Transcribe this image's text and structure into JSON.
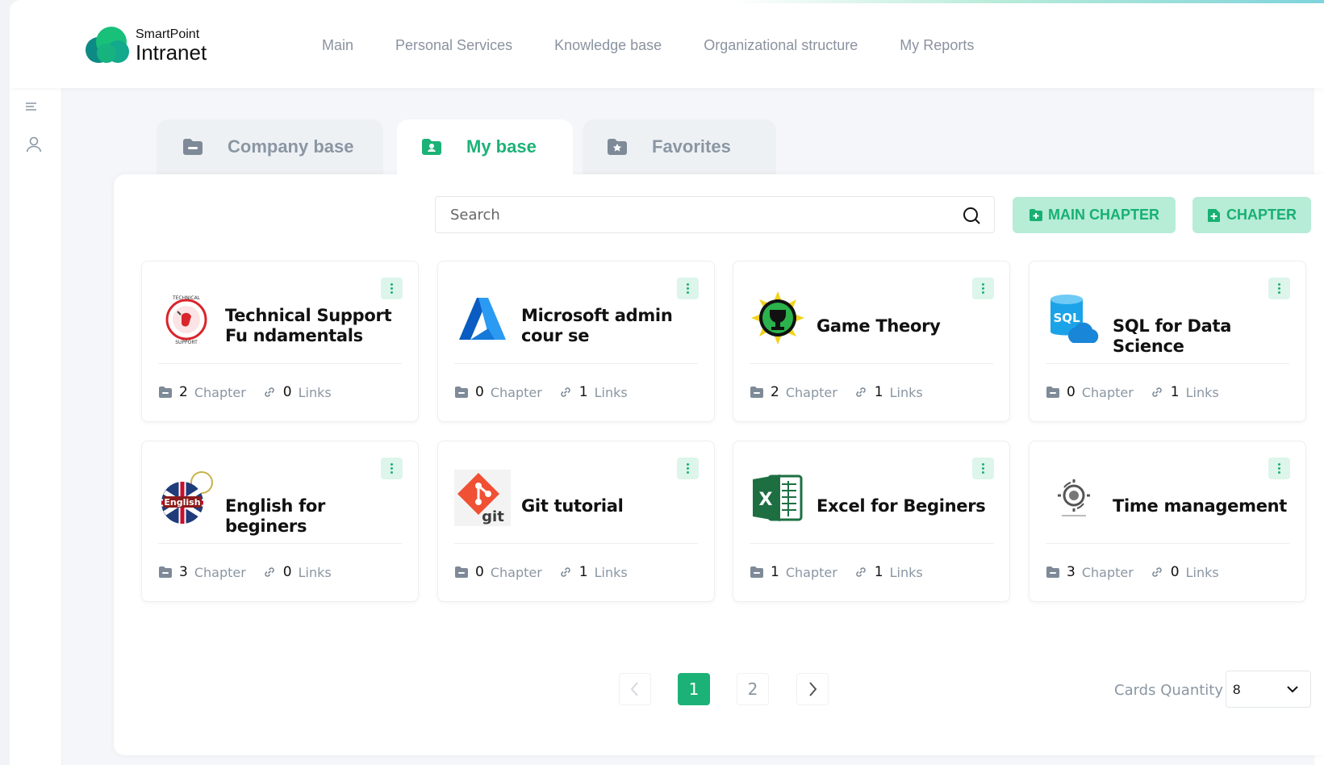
{
  "app": {
    "brand_line1": "SmartPoint",
    "brand_line2": "Intranet"
  },
  "nav": [
    "Main",
    "Personal Services",
    "Knowledge base",
    "Organizational structure",
    "My Reports"
  ],
  "rail_icons": [
    "menu-icon",
    "user-icon"
  ],
  "tabs": [
    {
      "label": "Company base",
      "icon": "folder-minus-icon",
      "active": false
    },
    {
      "label": "My base",
      "icon": "folder-user-icon",
      "active": true
    },
    {
      "label": "Favorites",
      "icon": "folder-star-icon",
      "active": false
    }
  ],
  "search": {
    "placeholder": "Search",
    "value": ""
  },
  "buttons": {
    "main_chapter": "MAIN CHAPTER",
    "chapter": "CHAPTER"
  },
  "stats_labels": {
    "chapter": "Chapter",
    "links": "Links"
  },
  "cards": [
    {
      "title": "Technical Support Fu ndamentals",
      "chapters": "2",
      "links": "0",
      "image": "technical-support-logo"
    },
    {
      "title": "Microsoft admin cour se",
      "chapters": "0",
      "links": "1",
      "image": "azure-logo"
    },
    {
      "title": "Game Theory",
      "chapters": "2",
      "links": "1",
      "image": "game-theory-logo"
    },
    {
      "title": "SQL for Data Science",
      "chapters": "0",
      "links": "1",
      "image": "sql-cloud-logo"
    },
    {
      "title": "English for beginers",
      "chapters": "3",
      "links": "0",
      "image": "english-flag-logo"
    },
    {
      "title": "Git tutorial",
      "chapters": "0",
      "links": "1",
      "image": "git-logo"
    },
    {
      "title": "Excel for Beginers",
      "chapters": "1",
      "links": "1",
      "image": "excel-logo"
    },
    {
      "title": "Time management",
      "chapters": "3",
      "links": "0",
      "image": "time-management-logo"
    }
  ],
  "card_image_text": {
    "english": "English",
    "git": "git",
    "sql": "SQL",
    "excel": "X"
  },
  "pagination": {
    "pages": [
      "1",
      "2"
    ],
    "current": "1"
  },
  "cards_quantity": {
    "label": "Cards Quantity",
    "value": "8"
  },
  "colors": {
    "accent": "#1cb277",
    "accent_soft": "#b7ecd7",
    "muted_text": "#8a96a3"
  }
}
